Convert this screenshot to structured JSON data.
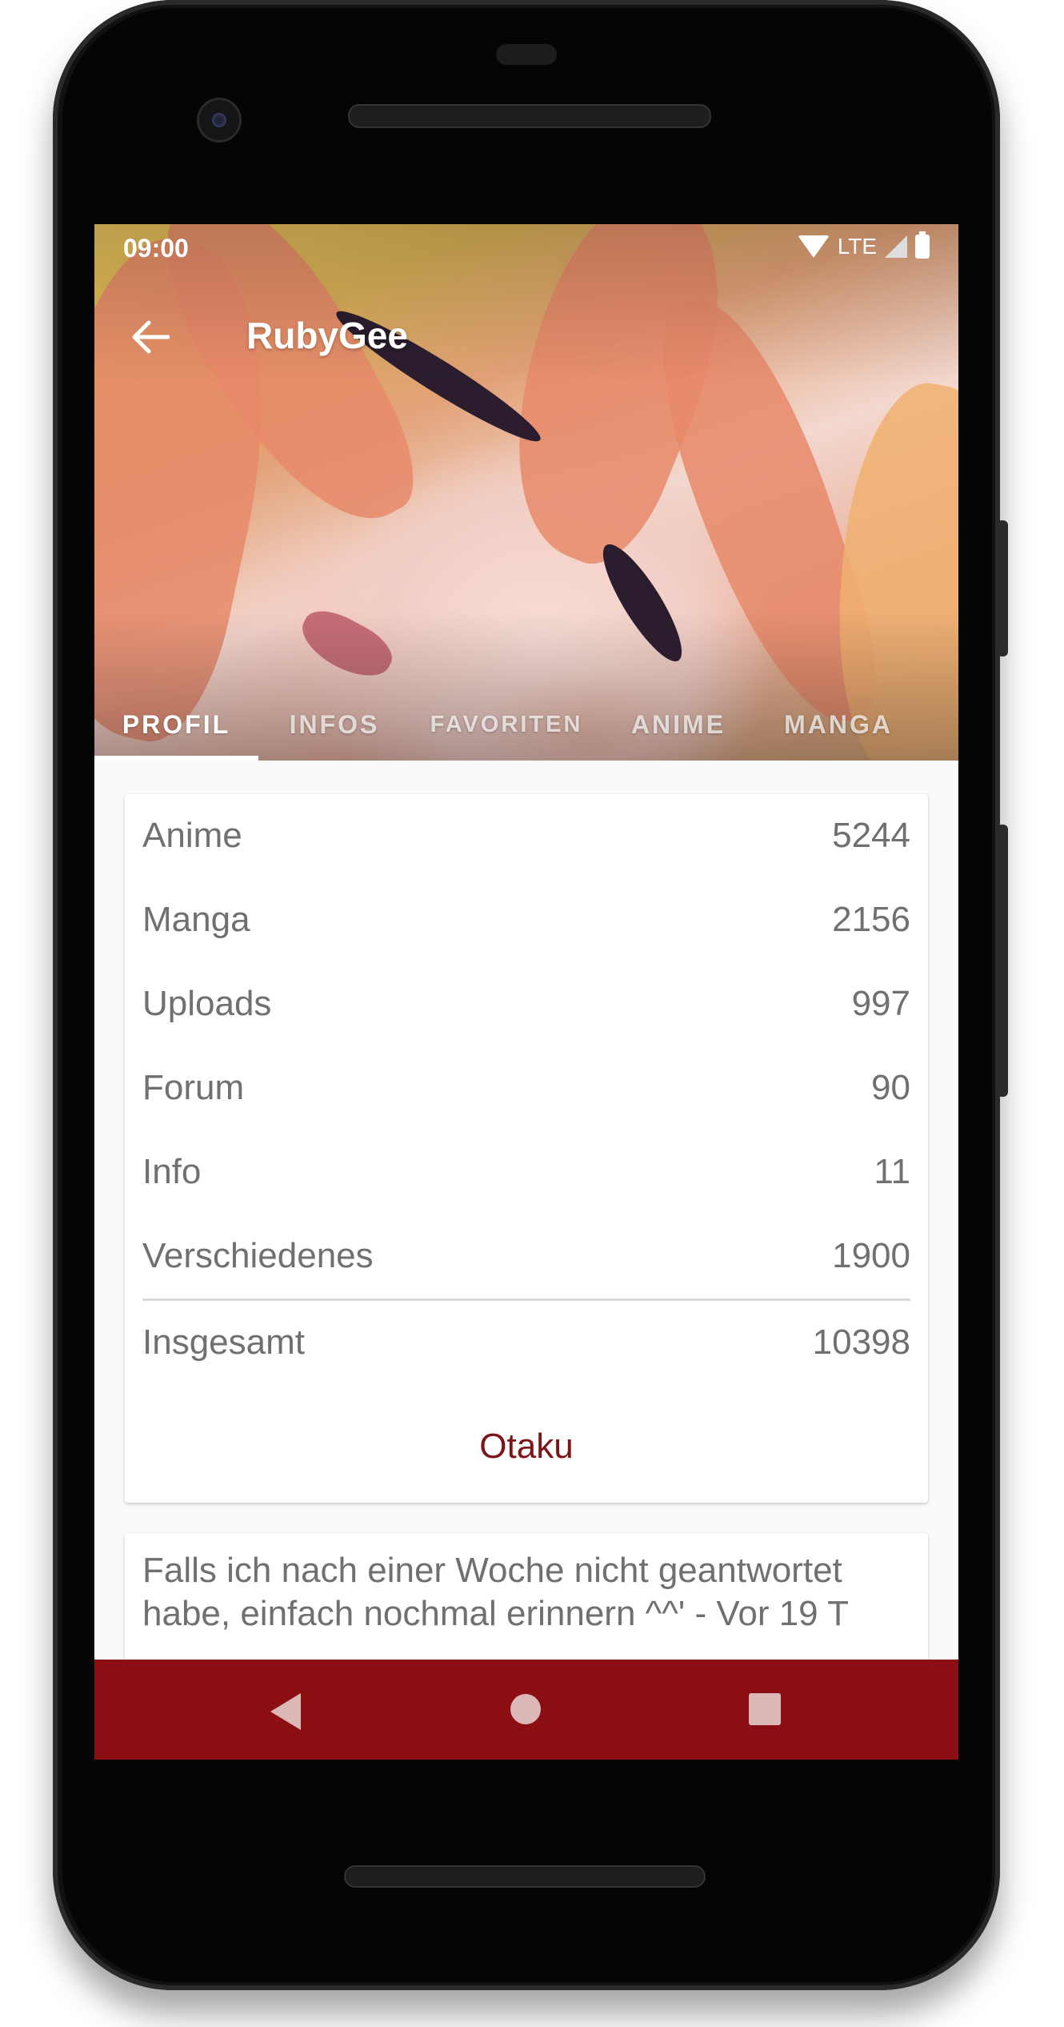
{
  "status_bar": {
    "time": "09:00",
    "network": "LTE"
  },
  "toolbar": {
    "title": "RubyGee"
  },
  "tabs": [
    {
      "label": "PROFIL"
    },
    {
      "label": "INFOS"
    },
    {
      "label": "FAVORITEN"
    },
    {
      "label": "ANIME"
    },
    {
      "label": "MANGA"
    }
  ],
  "stats": {
    "rows": [
      {
        "label": "Anime",
        "value": "5244"
      },
      {
        "label": "Manga",
        "value": "2156"
      },
      {
        "label": "Uploads",
        "value": "997"
      },
      {
        "label": "Forum",
        "value": "90"
      },
      {
        "label": "Info",
        "value": "11"
      },
      {
        "label": "Verschiedenes",
        "value": "1900"
      }
    ],
    "total": {
      "label": "Insgesamt",
      "value": "10398"
    },
    "rank": "Otaku"
  },
  "status_message": {
    "text": "Falls ich nach einer Woche nicht geantwortet habe, einfach nochmal erinnern ^^' - Vor 19 T"
  },
  "colors": {
    "accent": "#8b0f12",
    "rank": "#7d1418",
    "text_secondary": "#707070"
  }
}
